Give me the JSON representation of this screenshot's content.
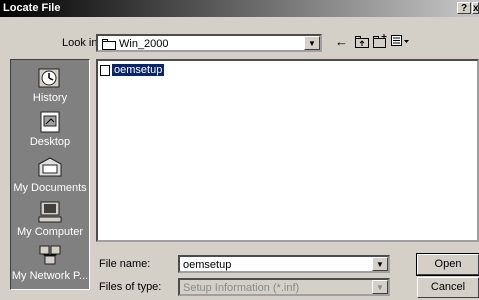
{
  "window": {
    "title": "Locate File",
    "help_btn": "?",
    "close_btn": "x"
  },
  "lookin": {
    "label": "Look in:",
    "value": "Win_2000"
  },
  "toolbar": {
    "back": "←",
    "up": "⮌",
    "newfolder": "★",
    "views": "▦▾"
  },
  "places": [
    {
      "label": "History"
    },
    {
      "label": "Desktop"
    },
    {
      "label": "My Documents"
    },
    {
      "label": "My Computer"
    },
    {
      "label": "My Network P..."
    }
  ],
  "files": [
    {
      "name": "oemsetup"
    }
  ],
  "filename": {
    "label": "File name:",
    "value": "oemsetup"
  },
  "filetype": {
    "label": "Files of type:",
    "value": "Setup Information (*.inf)"
  },
  "buttons": {
    "open": "Open",
    "cancel": "Cancel"
  },
  "icons": {
    "history": "history-icon",
    "desktop": "desktop-icon",
    "documents": "my-documents-icon",
    "computer": "my-computer-icon",
    "network": "network-icon"
  }
}
